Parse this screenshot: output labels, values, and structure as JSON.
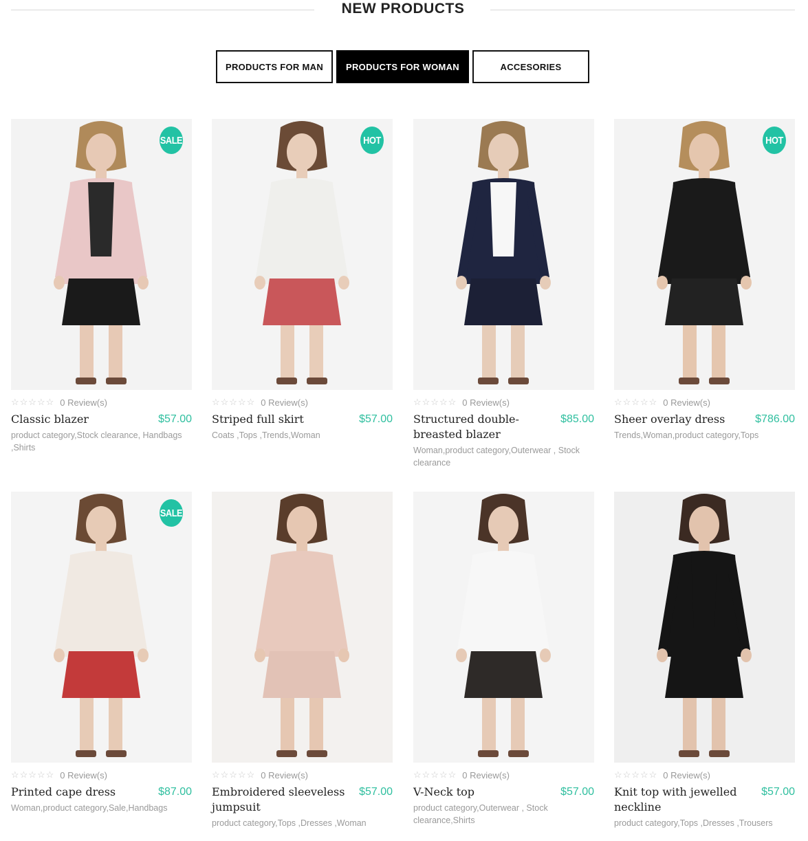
{
  "section": {
    "title": "NEW PRODUCTS"
  },
  "tabs": [
    {
      "label": "PRODUCTS FOR MAN",
      "active": false
    },
    {
      "label": "PRODUCTS FOR WOMAN",
      "active": true
    },
    {
      "label": "ACCESORIES",
      "active": false
    }
  ],
  "colors": {
    "accent": "#22c2a4",
    "price": "#2fbf9f",
    "active_tab_bg": "#000000"
  },
  "rating_stars": "☆☆☆☆☆",
  "products": [
    {
      "name": "Classic blazer",
      "price": "$57.00",
      "reviews": "0 Review(s)",
      "badge": "SALE",
      "categories": "product category,Stock clearance, Handbags ,Shirts"
    },
    {
      "name": "Striped full skirt",
      "price": "$57.00",
      "reviews": "0 Review(s)",
      "badge": "HOT",
      "categories": "Coats ,Tops ,Trends,Woman"
    },
    {
      "name": "Structured double-breasted blazer",
      "price": "$85.00",
      "reviews": "0 Review(s)",
      "badge": "",
      "categories": "Woman,product category,Outerwear , Stock clearance"
    },
    {
      "name": "Sheer overlay dress",
      "price": "$786.00",
      "reviews": "0 Review(s)",
      "badge": "HOT",
      "categories": "Trends,Woman,product category,Tops"
    },
    {
      "name": "Printed cape dress",
      "price": "$87.00",
      "reviews": "0 Review(s)",
      "badge": "SALE",
      "categories": "Woman,product category,Sale,Handbags"
    },
    {
      "name": "Embroidered sleeveless jumpsuit",
      "price": "$57.00",
      "reviews": "0 Review(s)",
      "badge": "",
      "categories": "product category,Tops ,Dresses ,Woman"
    },
    {
      "name": "V-Neck top",
      "price": "$57.00",
      "reviews": "0 Review(s)",
      "badge": "",
      "categories": "product category,Outerwear , Stock clearance,Shirts"
    },
    {
      "name": "Knit top with jewelled neckline",
      "price": "$57.00",
      "reviews": "0 Review(s)",
      "badge": "",
      "categories": "product category,Tops ,Dresses ,Trousers"
    }
  ]
}
